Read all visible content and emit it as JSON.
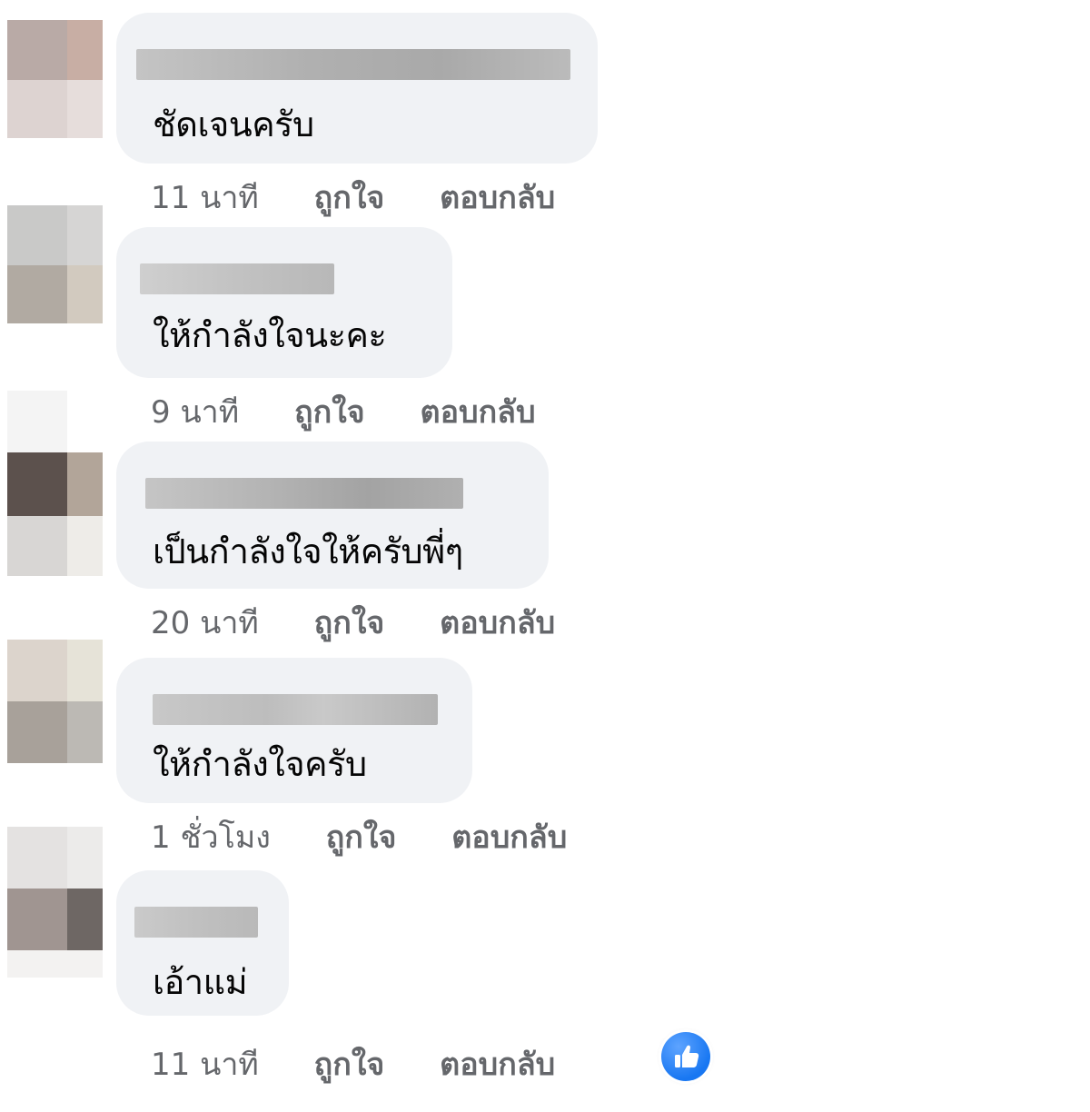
{
  "comments": [
    {
      "text": "ชัดเจนครับ",
      "time": "11 นาที",
      "like_label": "ถูกใจ",
      "reply_label": "ตอบกลับ",
      "avatar_colors": [
        "#b9aaa6",
        "#c8aea4",
        "#ddd3d1",
        "#e6dddb"
      ]
    },
    {
      "text": "ให้กำลังใจนะคะ",
      "time": "9 นาที",
      "like_label": "ถูกใจ",
      "reply_label": "ตอบกลับ",
      "avatar_colors": [
        "#c9c9c8",
        "#d6d5d4",
        "#b1aaa2",
        "#d2cabf"
      ]
    },
    {
      "text": "เป็นกำลังใจให้ครับพี่ๆ",
      "time": "20 นาที",
      "like_label": "ถูกใจ",
      "reply_label": "ตอบกลับ",
      "avatar_colors": [
        "#5c514d",
        "#b2a599",
        "#d8d6d4",
        "#eeece8"
      ]
    },
    {
      "text": "ให้กำลังใจครับ",
      "time": "1 ชั่วโมง",
      "like_label": "ถูกใจ",
      "reply_label": "ตอบกลับ",
      "avatar_colors": [
        "#dcd4cc",
        "#e6e3d8",
        "#a8a19a",
        "#bcb9b4"
      ]
    },
    {
      "text": "เอ้าแม่",
      "time": "11 นาที",
      "like_label": "ถูกใจ",
      "reply_label": "ตอบกลับ",
      "avatar_colors": [
        "#e4e2e1",
        "#ecebea",
        "#a09591",
        "#6e6764"
      ],
      "reaction": "like-icon"
    }
  ],
  "colors": {
    "bubble": "#f0f2f5",
    "text": "#050505",
    "meta": "#65676b",
    "reaction_blue": "#1877f2",
    "name_blur": "#b5b5b5"
  }
}
